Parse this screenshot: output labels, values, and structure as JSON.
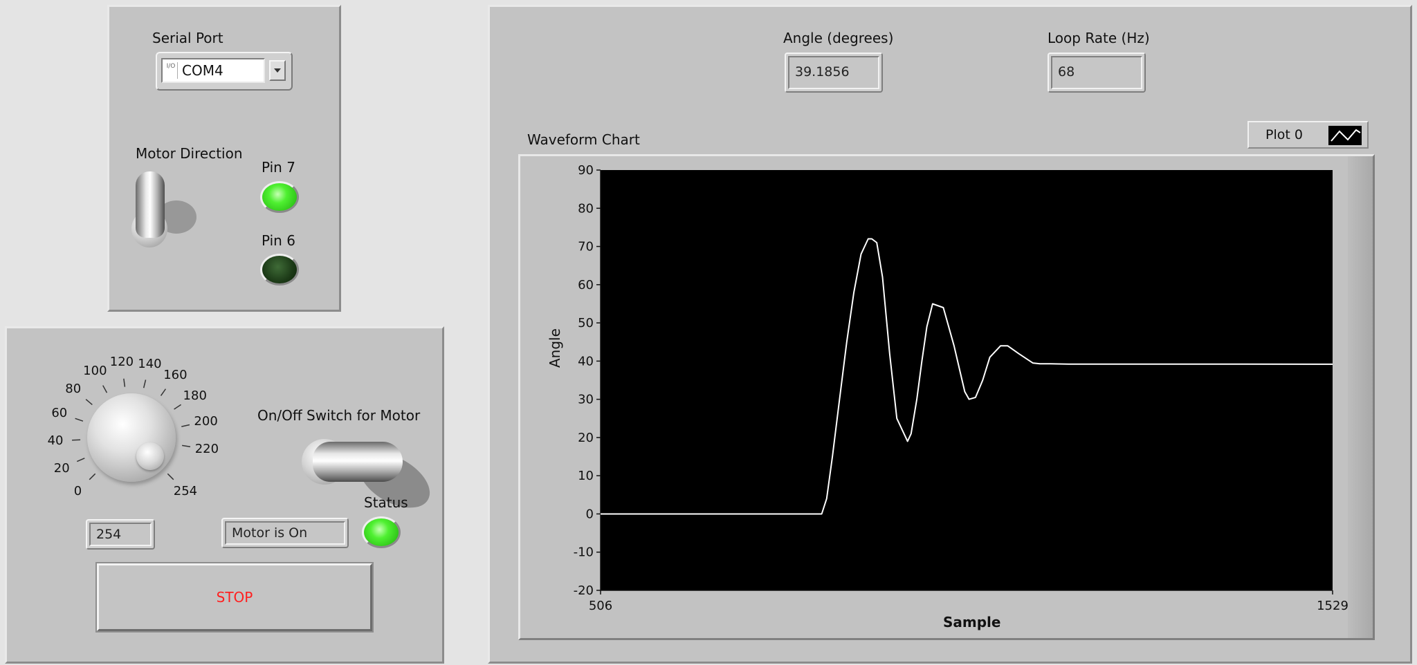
{
  "serial": {
    "label": "Serial Port",
    "io_glyph": "I/O",
    "value": "COM4"
  },
  "motor_direction": {
    "label": "Motor Direction",
    "pin7_label": "Pin 7",
    "pin7_on": true,
    "pin6_label": "Pin 6",
    "pin6_on": false
  },
  "speed": {
    "knob_labels": [
      "0",
      "20",
      "40",
      "60",
      "80",
      "100",
      "120",
      "140",
      "160",
      "180",
      "200",
      "220",
      "254"
    ],
    "value": "254",
    "knob_min": 0,
    "knob_max": 254,
    "knob_value": 254
  },
  "motor_switch": {
    "label": "On/Off Switch for Motor",
    "status_text": "Motor is On",
    "status_label": "Status",
    "status_on": true
  },
  "stop_button": {
    "label": "STOP"
  },
  "readouts": {
    "angle_label": "Angle (degrees)",
    "angle_value": "39.1856",
    "loop_label": "Loop Rate (Hz)",
    "loop_value": "68"
  },
  "chart_data": {
    "type": "line",
    "title": "Waveform Chart",
    "xlabel": "Sample",
    "ylabel": "Angle",
    "xlim": [
      506,
      1529
    ],
    "ylim": [
      -20,
      90
    ],
    "x_tick_labels": [
      "506",
      "1529"
    ],
    "y_ticks": [
      90,
      80,
      70,
      60,
      50,
      40,
      30,
      20,
      10,
      0,
      -10,
      -20
    ],
    "grid": false,
    "legend": "top-right",
    "series": [
      {
        "name": "Plot 0",
        "color": "#ffffff",
        "x": [
          506,
          700,
          815,
          822,
          830,
          840,
          850,
          860,
          870,
          880,
          885,
          892,
          900,
          910,
          920,
          935,
          940,
          948,
          955,
          962,
          970,
          985,
          1000,
          1010,
          1015,
          1021,
          1030,
          1040,
          1050,
          1065,
          1075,
          1090,
          1110,
          1120,
          1135,
          1160,
          1200,
          1300,
          1400,
          1529
        ],
        "values": [
          0,
          0,
          0,
          4,
          15,
          30,
          45,
          58,
          68,
          72,
          72,
          71,
          62,
          42,
          25,
          19,
          21,
          30,
          40,
          49,
          55,
          54,
          44,
          36,
          32,
          30,
          30.5,
          35,
          41,
          44,
          44,
          42,
          39.5,
          39.3,
          39.3,
          39.2,
          39.2,
          39.2,
          39.2,
          39.1856
        ]
      }
    ]
  }
}
